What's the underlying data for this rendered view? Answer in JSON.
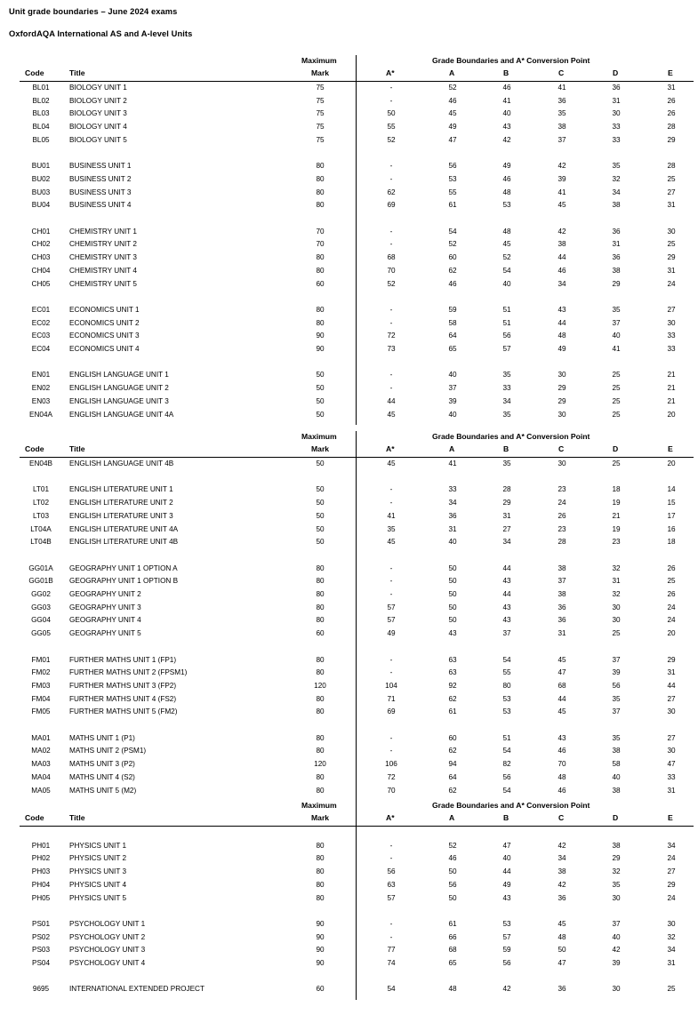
{
  "document": {
    "title": "Unit grade boundaries – June 2024 exams",
    "subtitle": "OxfordAQA International AS and A-level Units"
  },
  "columns": {
    "code": "Code",
    "title": "Title",
    "maximum": "Maximum",
    "mark": "Mark",
    "grade_group": "Grade Boundaries and A* Conversion Point",
    "astar": "A*",
    "a": "A",
    "b": "B",
    "c": "C",
    "d": "D",
    "e": "E"
  },
  "empty_value": "-",
  "tables": [
    {
      "id": "table-1",
      "rows": [
        {
          "code": "BL01",
          "title": "BIOLOGY UNIT 1",
          "max": "75",
          "astar": "-",
          "a": "52",
          "b": "46",
          "c": "41",
          "d": "36",
          "e": "31"
        },
        {
          "code": "BL02",
          "title": "BIOLOGY UNIT 2",
          "max": "75",
          "astar": "-",
          "a": "46",
          "b": "41",
          "c": "36",
          "d": "31",
          "e": "26"
        },
        {
          "code": "BL03",
          "title": "BIOLOGY UNIT 3",
          "max": "75",
          "astar": "50",
          "a": "45",
          "b": "40",
          "c": "35",
          "d": "30",
          "e": "26"
        },
        {
          "code": "BL04",
          "title": "BIOLOGY UNIT 4",
          "max": "75",
          "astar": "55",
          "a": "49",
          "b": "43",
          "c": "38",
          "d": "33",
          "e": "28"
        },
        {
          "code": "BL05",
          "title": "BIOLOGY UNIT 5",
          "max": "75",
          "astar": "52",
          "a": "47",
          "b": "42",
          "c": "37",
          "d": "33",
          "e": "29"
        },
        {
          "spacer": true
        },
        {
          "code": "BU01",
          "title": "BUSINESS UNIT 1",
          "max": "80",
          "astar": "-",
          "a": "56",
          "b": "49",
          "c": "42",
          "d": "35",
          "e": "28"
        },
        {
          "code": "BU02",
          "title": "BUSINESS UNIT 2",
          "max": "80",
          "astar": "-",
          "a": "53",
          "b": "46",
          "c": "39",
          "d": "32",
          "e": "25"
        },
        {
          "code": "BU03",
          "title": "BUSINESS UNIT 3",
          "max": "80",
          "astar": "62",
          "a": "55",
          "b": "48",
          "c": "41",
          "d": "34",
          "e": "27"
        },
        {
          "code": "BU04",
          "title": "BUSINESS UNIT 4",
          "max": "80",
          "astar": "69",
          "a": "61",
          "b": "53",
          "c": "45",
          "d": "38",
          "e": "31"
        },
        {
          "spacer": true
        },
        {
          "code": "CH01",
          "title": "CHEMISTRY UNIT 1",
          "max": "70",
          "astar": "-",
          "a": "54",
          "b": "48",
          "c": "42",
          "d": "36",
          "e": "30"
        },
        {
          "code": "CH02",
          "title": "CHEMISTRY UNIT 2",
          "max": "70",
          "astar": "-",
          "a": "52",
          "b": "45",
          "c": "38",
          "d": "31",
          "e": "25"
        },
        {
          "code": "CH03",
          "title": "CHEMISTRY UNIT 3",
          "max": "80",
          "astar": "68",
          "a": "60",
          "b": "52",
          "c": "44",
          "d": "36",
          "e": "29"
        },
        {
          "code": "CH04",
          "title": "CHEMISTRY UNIT 4",
          "max": "80",
          "astar": "70",
          "a": "62",
          "b": "54",
          "c": "46",
          "d": "38",
          "e": "31"
        },
        {
          "code": "CH05",
          "title": "CHEMISTRY UNIT 5",
          "max": "60",
          "astar": "52",
          "a": "46",
          "b": "40",
          "c": "34",
          "d": "29",
          "e": "24"
        },
        {
          "spacer": true
        },
        {
          "code": "EC01",
          "title": "ECONOMICS UNIT 1",
          "max": "80",
          "astar": "-",
          "a": "59",
          "b": "51",
          "c": "43",
          "d": "35",
          "e": "27"
        },
        {
          "code": "EC02",
          "title": "ECONOMICS UNIT 2",
          "max": "80",
          "astar": "-",
          "a": "58",
          "b": "51",
          "c": "44",
          "d": "37",
          "e": "30"
        },
        {
          "code": "EC03",
          "title": "ECONOMICS UNIT 3",
          "max": "90",
          "astar": "72",
          "a": "64",
          "b": "56",
          "c": "48",
          "d": "40",
          "e": "33"
        },
        {
          "code": "EC04",
          "title": "ECONOMICS UNIT 4",
          "max": "90",
          "astar": "73",
          "a": "65",
          "b": "57",
          "c": "49",
          "d": "41",
          "e": "33"
        },
        {
          "spacer": true
        },
        {
          "code": "EN01",
          "title": "ENGLISH LANGUAGE UNIT 1",
          "max": "50",
          "astar": "-",
          "a": "40",
          "b": "35",
          "c": "30",
          "d": "25",
          "e": "21"
        },
        {
          "code": "EN02",
          "title": "ENGLISH LANGUAGE UNIT 2",
          "max": "50",
          "astar": "-",
          "a": "37",
          "b": "33",
          "c": "29",
          "d": "25",
          "e": "21"
        },
        {
          "code": "EN03",
          "title": "ENGLISH LANGUAGE UNIT 3",
          "max": "50",
          "astar": "44",
          "a": "39",
          "b": "34",
          "c": "29",
          "d": "25",
          "e": "21"
        },
        {
          "code": "EN04A",
          "title": "ENGLISH LANGUAGE UNIT 4A",
          "max": "50",
          "astar": "45",
          "a": "40",
          "b": "35",
          "c": "30",
          "d": "25",
          "e": "20"
        }
      ]
    },
    {
      "id": "table-2",
      "rows": [
        {
          "code": "EN04B",
          "title": "ENGLISH LANGUAGE UNIT 4B",
          "max": "50",
          "astar": "45",
          "a": "41",
          "b": "35",
          "c": "30",
          "d": "25",
          "e": "20"
        },
        {
          "spacer": true
        },
        {
          "code": "LT01",
          "title": "ENGLISH LITERATURE UNIT 1",
          "max": "50",
          "astar": "-",
          "a": "33",
          "b": "28",
          "c": "23",
          "d": "18",
          "e": "14"
        },
        {
          "code": "LT02",
          "title": "ENGLISH LITERATURE UNIT 2",
          "max": "50",
          "astar": "-",
          "a": "34",
          "b": "29",
          "c": "24",
          "d": "19",
          "e": "15"
        },
        {
          "code": "LT03",
          "title": "ENGLISH LITERATURE UNIT 3",
          "max": "50",
          "astar": "41",
          "a": "36",
          "b": "31",
          "c": "26",
          "d": "21",
          "e": "17"
        },
        {
          "code": "LT04A",
          "title": "ENGLISH LITERATURE UNIT 4A",
          "max": "50",
          "astar": "35",
          "a": "31",
          "b": "27",
          "c": "23",
          "d": "19",
          "e": "16"
        },
        {
          "code": "LT04B",
          "title": "ENGLISH LITERATURE UNIT 4B",
          "max": "50",
          "astar": "45",
          "a": "40",
          "b": "34",
          "c": "28",
          "d": "23",
          "e": "18"
        },
        {
          "spacer": true
        },
        {
          "code": "GG01A",
          "title": "GEOGRAPHY UNIT 1 OPTION A",
          "max": "80",
          "astar": "-",
          "a": "50",
          "b": "44",
          "c": "38",
          "d": "32",
          "e": "26"
        },
        {
          "code": "GG01B",
          "title": "GEOGRAPHY UNIT 1 OPTION B",
          "max": "80",
          "astar": "-",
          "a": "50",
          "b": "43",
          "c": "37",
          "d": "31",
          "e": "25"
        },
        {
          "code": "GG02",
          "title": "GEOGRAPHY UNIT 2",
          "max": "80",
          "astar": "-",
          "a": "50",
          "b": "44",
          "c": "38",
          "d": "32",
          "e": "26"
        },
        {
          "code": "GG03",
          "title": "GEOGRAPHY UNIT 3",
          "max": "80",
          "astar": "57",
          "a": "50",
          "b": "43",
          "c": "36",
          "d": "30",
          "e": "24"
        },
        {
          "code": "GG04",
          "title": "GEOGRAPHY UNIT 4",
          "max": "80",
          "astar": "57",
          "a": "50",
          "b": "43",
          "c": "36",
          "d": "30",
          "e": "24"
        },
        {
          "code": "GG05",
          "title": "GEOGRAPHY UNIT 5",
          "max": "60",
          "astar": "49",
          "a": "43",
          "b": "37",
          "c": "31",
          "d": "25",
          "e": "20"
        },
        {
          "spacer": true
        },
        {
          "code": "FM01",
          "title": "FURTHER MATHS UNIT 1 (FP1)",
          "max": "80",
          "astar": "-",
          "a": "63",
          "b": "54",
          "c": "45",
          "d": "37",
          "e": "29"
        },
        {
          "code": "FM02",
          "title": "FURTHER MATHS UNIT 2 (FPSM1)",
          "max": "80",
          "astar": "-",
          "a": "63",
          "b": "55",
          "c": "47",
          "d": "39",
          "e": "31"
        },
        {
          "code": "FM03",
          "title": "FURTHER MATHS UNIT 3 (FP2)",
          "max": "120",
          "astar": "104",
          "a": "92",
          "b": "80",
          "c": "68",
          "d": "56",
          "e": "44"
        },
        {
          "code": "FM04",
          "title": "FURTHER MATHS UNIT 4 (FS2)",
          "max": "80",
          "astar": "71",
          "a": "62",
          "b": "53",
          "c": "44",
          "d": "35",
          "e": "27"
        },
        {
          "code": "FM05",
          "title": "FURTHER MATHS UNIT 5 (FM2)",
          "max": "80",
          "astar": "69",
          "a": "61",
          "b": "53",
          "c": "45",
          "d": "37",
          "e": "30"
        },
        {
          "spacer": true
        },
        {
          "code": "MA01",
          "title": "MATHS UNIT 1 (P1)",
          "max": "80",
          "astar": "-",
          "a": "60",
          "b": "51",
          "c": "43",
          "d": "35",
          "e": "27"
        },
        {
          "code": "MA02",
          "title": "MATHS UNIT 2 (PSM1)",
          "max": "80",
          "astar": "-",
          "a": "62",
          "b": "54",
          "c": "46",
          "d": "38",
          "e": "30"
        },
        {
          "code": "MA03",
          "title": "MATHS UNIT 3 (P2)",
          "max": "120",
          "astar": "106",
          "a": "94",
          "b": "82",
          "c": "70",
          "d": "58",
          "e": "47"
        },
        {
          "code": "MA04",
          "title": "MATHS UNIT 4 (S2)",
          "max": "80",
          "astar": "72",
          "a": "64",
          "b": "56",
          "c": "48",
          "d": "40",
          "e": "33"
        },
        {
          "code": "MA05",
          "title": "MATHS UNIT 5 (M2)",
          "max": "80",
          "astar": "70",
          "a": "62",
          "b": "54",
          "c": "46",
          "d": "38",
          "e": "31"
        }
      ]
    },
    {
      "id": "table-3",
      "rows": [
        {
          "spacer": true
        },
        {
          "code": "PH01",
          "title": "PHYSICS UNIT 1",
          "max": "80",
          "astar": "-",
          "a": "52",
          "b": "47",
          "c": "42",
          "d": "38",
          "e": "34"
        },
        {
          "code": "PH02",
          "title": "PHYSICS UNIT 2",
          "max": "80",
          "astar": "-",
          "a": "46",
          "b": "40",
          "c": "34",
          "d": "29",
          "e": "24"
        },
        {
          "code": "PH03",
          "title": "PHYSICS UNIT 3",
          "max": "80",
          "astar": "56",
          "a": "50",
          "b": "44",
          "c": "38",
          "d": "32",
          "e": "27"
        },
        {
          "code": "PH04",
          "title": "PHYSICS UNIT 4",
          "max": "80",
          "astar": "63",
          "a": "56",
          "b": "49",
          "c": "42",
          "d": "35",
          "e": "29"
        },
        {
          "code": "PH05",
          "title": "PHYSICS UNIT 5",
          "max": "80",
          "astar": "57",
          "a": "50",
          "b": "43",
          "c": "36",
          "d": "30",
          "e": "24"
        },
        {
          "spacer": true
        },
        {
          "code": "PS01",
          "title": "PSYCHOLOGY UNIT 1",
          "max": "90",
          "astar": "-",
          "a": "61",
          "b": "53",
          "c": "45",
          "d": "37",
          "e": "30"
        },
        {
          "code": "PS02",
          "title": "PSYCHOLOGY UNIT 2",
          "max": "90",
          "astar": "-",
          "a": "66",
          "b": "57",
          "c": "48",
          "d": "40",
          "e": "32"
        },
        {
          "code": "PS03",
          "title": "PSYCHOLOGY UNIT 3",
          "max": "90",
          "astar": "77",
          "a": "68",
          "b": "59",
          "c": "50",
          "d": "42",
          "e": "34"
        },
        {
          "code": "PS04",
          "title": "PSYCHOLOGY UNIT 4",
          "max": "90",
          "astar": "74",
          "a": "65",
          "b": "56",
          "c": "47",
          "d": "39",
          "e": "31"
        },
        {
          "spacer": true
        },
        {
          "code": "9695",
          "title": "INTERNATIONAL EXTENDED PROJECT",
          "max": "60",
          "astar": "54",
          "a": "48",
          "b": "42",
          "c": "36",
          "d": "30",
          "e": "25"
        }
      ]
    }
  ]
}
